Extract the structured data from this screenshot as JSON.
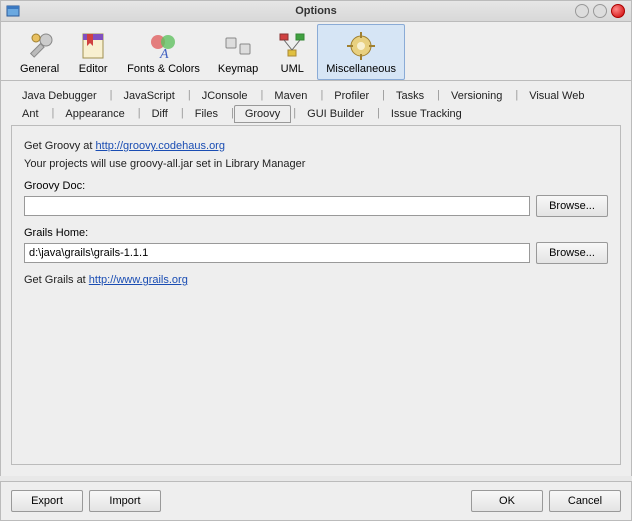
{
  "window": {
    "title": "Options"
  },
  "toolbar": {
    "items": [
      {
        "label": "General"
      },
      {
        "label": "Editor"
      },
      {
        "label": "Fonts & Colors"
      },
      {
        "label": "Keymap"
      },
      {
        "label": "UML"
      },
      {
        "label": "Miscellaneous"
      }
    ],
    "selected_index": 5
  },
  "tabs": {
    "row1": [
      "Java Debugger",
      "JavaScript",
      "JConsole",
      "Maven",
      "Profiler",
      "Tasks",
      "Versioning",
      "Visual Web"
    ],
    "row2": [
      "Ant",
      "Appearance",
      "Diff",
      "Files",
      "Groovy",
      "GUI Builder",
      "Issue Tracking"
    ],
    "active": "Groovy"
  },
  "panel": {
    "get_groovy_label": "Get Groovy at ",
    "groovy_link": "http://groovy.codehaus.org",
    "jar_msg": "Your projects will use groovy-all.jar set in Library Manager",
    "doc_label": "Groovy Doc:",
    "doc_value": "",
    "browse": "Browse...",
    "grails_label": "Grails Home:",
    "grails_value": "d:\\java\\grails\\grails-1.1.1",
    "get_grails_label": "Get Grails at ",
    "grails_link": "http://www.grails.org"
  },
  "footer": {
    "export": "Export",
    "import": "Import",
    "ok": "OK",
    "cancel": "Cancel"
  }
}
